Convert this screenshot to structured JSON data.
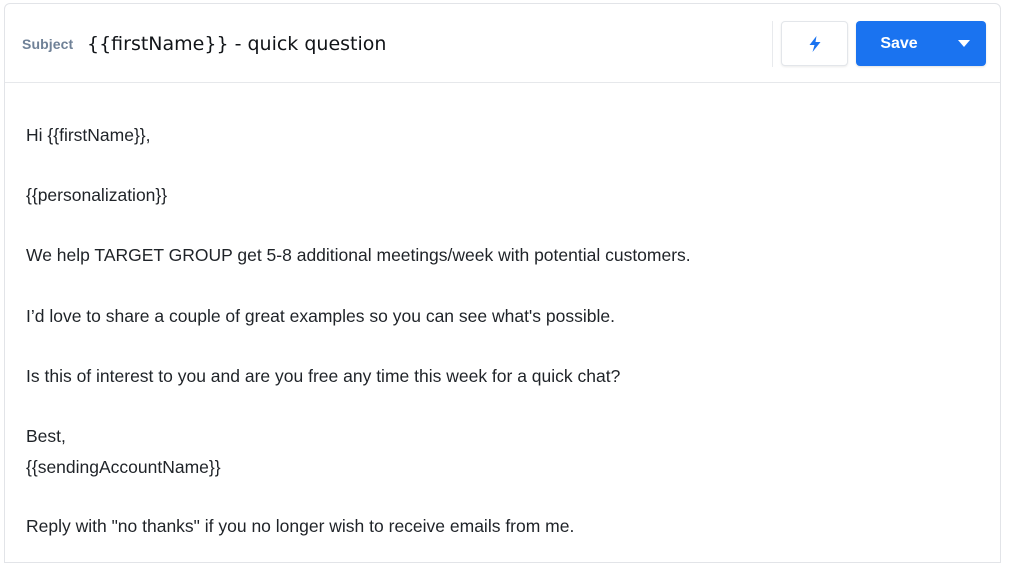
{
  "header": {
    "subject_label": "Subject",
    "subject_value": "{{firstName}} - quick question",
    "bolt_icon": "lightning-bolt-icon",
    "save_label": "Save",
    "caret_icon": "caret-down-icon",
    "accent_color": "#1a73f0"
  },
  "body": {
    "lines": [
      "Hi {{firstName}},",
      "{{personalization}}",
      "We help TARGET GROUP get 5-8 additional meetings/week with potential customers.",
      "I’d love to share a couple of great examples so you can see what's possible.",
      "Is this of interest to you and are you free any time this week for a quick chat?",
      "Best,",
      "{{sendingAccountName}}",
      "Reply with \"no thanks\" if you no longer wish to receive emails from me."
    ]
  }
}
